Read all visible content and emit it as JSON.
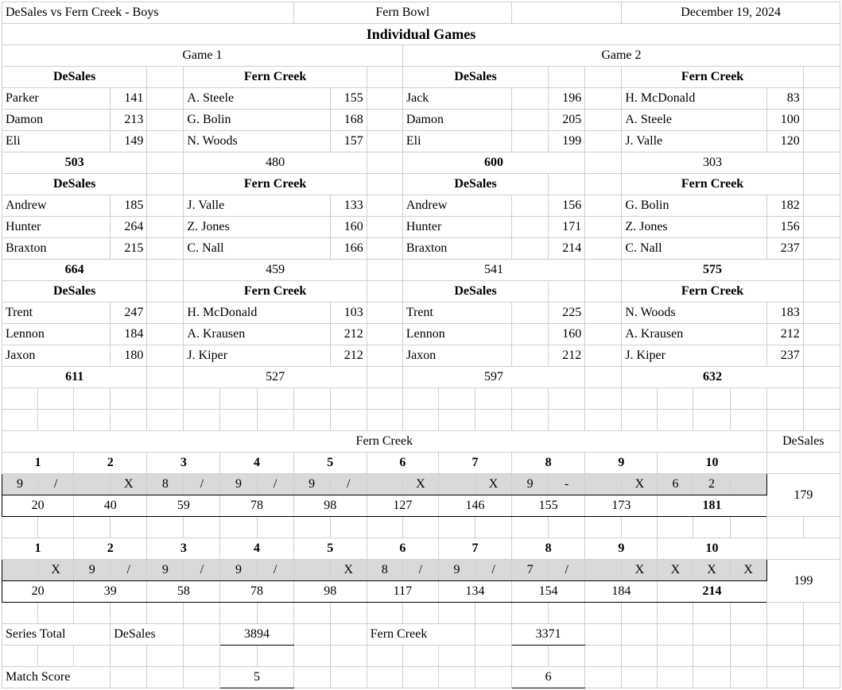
{
  "header": {
    "match": "DeSales vs Fern Creek - Boys",
    "venue": "Fern Bowl",
    "date": "December 19, 2024"
  },
  "sectionTitle": "Individual Games",
  "gameLabels": [
    "Game 1",
    "Game 2"
  ],
  "teams": {
    "a": "DeSales",
    "b": "Fern Creek"
  },
  "games": {
    "g1": {
      "a1": {
        "players": [
          "Parker",
          "Damon",
          "Eli"
        ],
        "scores": [
          141,
          213,
          149
        ],
        "total": 503,
        "bold": true
      },
      "b1": {
        "players": [
          "A. Steele",
          "G. Bolin",
          "N. Woods"
        ],
        "scores": [
          155,
          168,
          157
        ],
        "total": 480,
        "bold": false
      },
      "a2": {
        "players": [
          "Andrew",
          "Hunter",
          "Braxton"
        ],
        "scores": [
          185,
          264,
          215
        ],
        "total": 664,
        "bold": true
      },
      "b2": {
        "players": [
          "J. Valle",
          "Z. Jones",
          "C. Nall"
        ],
        "scores": [
          133,
          160,
          166
        ],
        "total": 459,
        "bold": false
      },
      "a3": {
        "players": [
          "Trent",
          "Lennon",
          "Jaxon"
        ],
        "scores": [
          247,
          184,
          180
        ],
        "total": 611,
        "bold": true
      },
      "b3": {
        "players": [
          "H. McDonald",
          "A. Krausen",
          "J. Kiper"
        ],
        "scores": [
          103,
          212,
          212
        ],
        "total": 527,
        "bold": false
      }
    },
    "g2": {
      "a1": {
        "players": [
          "Jack",
          "Damon",
          "Eli"
        ],
        "scores": [
          196,
          205,
          199
        ],
        "total": 600,
        "bold": true
      },
      "b1": {
        "players": [
          "H. McDonald",
          "A. Steele",
          "J. Valle"
        ],
        "scores": [
          83,
          100,
          120
        ],
        "total": 303,
        "bold": false
      },
      "a2": {
        "players": [
          "Andrew",
          "Hunter",
          "Braxton"
        ],
        "scores": [
          156,
          171,
          214
        ],
        "total": 541,
        "bold": false
      },
      "b2": {
        "players": [
          "G. Bolin",
          "Z. Jones",
          "C. Nall"
        ],
        "scores": [
          182,
          156,
          237
        ],
        "total": 575,
        "bold": true
      },
      "a3": {
        "players": [
          "Trent",
          "Lennon",
          "Jaxon"
        ],
        "scores": [
          225,
          160,
          212
        ],
        "total": 597,
        "bold": false
      },
      "b3": {
        "players": [
          "N. Woods",
          "A. Krausen",
          "J. Kiper"
        ],
        "scores": [
          183,
          212,
          237
        ],
        "total": 632,
        "bold": true
      }
    }
  },
  "baker": {
    "headerTeam": "Fern Creek",
    "vsTeam": "DeSales",
    "frames": [
      "1",
      "2",
      "3",
      "4",
      "5",
      "6",
      "7",
      "8",
      "9",
      "10"
    ],
    "line1": {
      "balls": [
        "9",
        "/",
        "",
        "X",
        "8",
        "/",
        "9",
        "/",
        "9",
        "/",
        "",
        "X",
        "",
        "X",
        "9",
        "-",
        "",
        "X",
        "6",
        "2",
        ""
      ],
      "cum": [
        "20",
        "40",
        "59",
        "78",
        "98",
        "127",
        "146",
        "155",
        "173",
        "181"
      ],
      "final": 181,
      "opp": 179
    },
    "line2": {
      "balls": [
        "",
        "X",
        "9",
        "/",
        "9",
        "/",
        "9",
        "/",
        "",
        "X",
        "8",
        "/",
        "9",
        "/",
        "7",
        "/",
        "",
        "X",
        "X",
        "X",
        "X"
      ],
      "cum": [
        "20",
        "39",
        "58",
        "78",
        "98",
        "117",
        "134",
        "154",
        "184",
        "214"
      ],
      "final": 214,
      "opp": 199
    }
  },
  "summary": {
    "seriesLabel": "Series Total",
    "matchLabel": "Match Score",
    "teamA": "DeSales",
    "teamB": "Fern Creek",
    "seriesA": 3894,
    "seriesB": 3371,
    "matchA": 5,
    "matchB": 6
  }
}
